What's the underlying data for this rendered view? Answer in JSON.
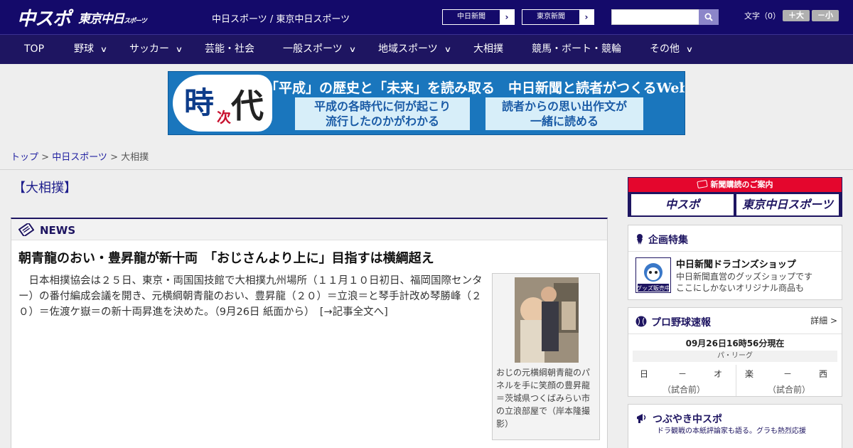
{
  "header": {
    "logo_chunichi": "中スポ",
    "logo_tokyo": "東京中日",
    "logo_tokyo_sub": "スポーツ",
    "site_names": "中日スポーツ / 東京中日スポーツ",
    "paper_chunichi": "中日新聞",
    "paper_tokyo": "東京新聞",
    "search_placeholder": "",
    "font_label": "文字（0）",
    "font_large": "＋大",
    "font_small": "－小"
  },
  "nav": [
    {
      "label": "TOP",
      "has_menu": false
    },
    {
      "label": "野球",
      "has_menu": true
    },
    {
      "label": "サッカー",
      "has_menu": true
    },
    {
      "label": "芸能・社会",
      "has_menu": false
    },
    {
      "label": "一般スポーツ",
      "has_menu": true
    },
    {
      "label": "地域スポーツ",
      "has_menu": true
    },
    {
      "label": "大相撲",
      "has_menu": false
    },
    {
      "label": "競馬・ボート・競輪",
      "has_menu": false
    },
    {
      "label": "その他",
      "has_menu": true
    }
  ],
  "banner": {
    "char1": "時",
    "char2": "次",
    "char3": "代",
    "headline": "「平成」の歴史と「未来」を読み取る　中日新聞と読者がつくるWebサイト",
    "box1_line1": "平成の各時代に何が起こり",
    "box1_line2": "流行したのかがわかる",
    "box2_line1": "読者からの思い出作文が",
    "box2_line2": "一緒に読める"
  },
  "breadcrumb": {
    "top": "トップ",
    "sep": " > ",
    "section": "中日スポーツ",
    "current": "大相撲"
  },
  "page_title": "【大相撲】",
  "news": {
    "label": "NEWS",
    "title": "朝青龍のおい・豊昇龍が新十両　「おじさんより上に」目指すは横綱超え",
    "body": "　日本相撲協会は２５日、東京・両国国技館で大相撲九州場所（１１月１０日初日、福岡国際センター）の番付編成会議を開き、元横綱朝青龍のおい、豊昇龍（２０）＝立浪＝と琴手計改め琴勝峰（２０）＝佐渡ケ嶽＝の新十両昇進を決めた。（9月26日 紙面から）　[→記事全文へ]",
    "photo_caption": "おじの元横綱朝青龍のパネルを手に笑顔の豊昇龍＝茨城県つくばみらい市の立浪部屋で（岸本隆撮影）"
  },
  "sidebar": {
    "subscribe_head": "新聞購読のご案内",
    "subscribe_btn1": "中スポ",
    "subscribe_btn2": "東京中日スポーツ",
    "feature_title": "企画特集",
    "feature_name": "中日新聞ドラゴンズショップ",
    "feature_desc1": "中日新聞直営のグッズショップです",
    "feature_desc2": "ここにしかないオリジナル商品も",
    "feature_thumb_label": "グッズ販売中",
    "score_title": "プロ野球速報",
    "score_detail": "詳細 >",
    "score_time": "09月26日16時56分現在",
    "league": "パ・リーグ",
    "games": [
      {
        "home": "日",
        "sep": "－",
        "away": "オ",
        "status": "（試合前）"
      },
      {
        "home": "楽",
        "sep": "－",
        "away": "西",
        "status": "（試合前）"
      }
    ],
    "tweet_title": "つぶやき中スポ",
    "tweet_sub": "ドラ観戦の本紙評論家も語る。グラも熱烈応援"
  },
  "colors": {
    "header_bg": "#140a6a",
    "nav_bg": "#1e1561",
    "accent_red": "#e4062d",
    "link": "#1e1ea0"
  }
}
